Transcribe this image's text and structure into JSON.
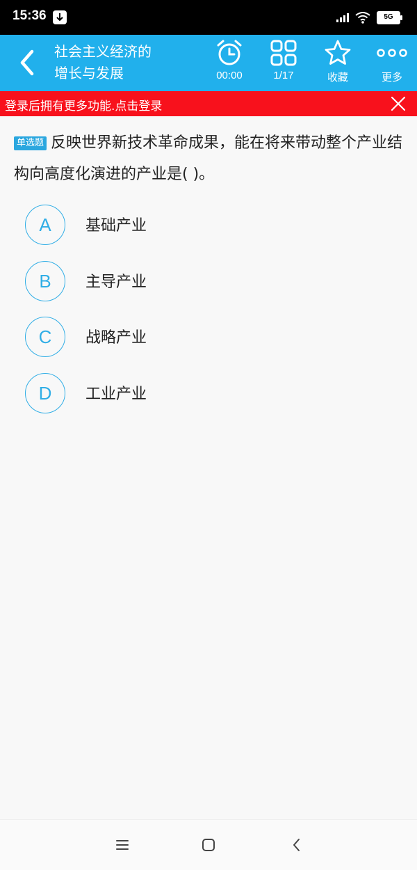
{
  "status_bar": {
    "time": "15:36",
    "network": "5G",
    "icons": [
      "download-icon",
      "signal-icon",
      "wifi-icon",
      "battery-icon"
    ]
  },
  "header": {
    "title_line1": "社会主义经济的",
    "title_line2": "增长与发展",
    "timer_label": "00:00",
    "progress_label": "1/17",
    "favorite_label": "收藏",
    "more_label": "更多",
    "icons": [
      "back-icon",
      "alarm-clock-icon",
      "grid-icon",
      "star-icon",
      "more-dots-icon"
    ]
  },
  "login_banner": {
    "text": "登录后拥有更多功能.点击登录",
    "icons": [
      "close-icon"
    ]
  },
  "question": {
    "badge": "单选题",
    "text": "反映世界新技术革命成果，能在将来带动整个产业结构向高度化演进的产业是(   )。",
    "options": [
      {
        "letter": "A",
        "text": "基础产业"
      },
      {
        "letter": "B",
        "text": "主导产业"
      },
      {
        "letter": "C",
        "text": "战略产业"
      },
      {
        "letter": "D",
        "text": "工业产业"
      }
    ]
  },
  "nav_bar": {
    "icons": [
      "menu-icon",
      "home-icon",
      "back-nav-icon"
    ]
  },
  "colors": {
    "header": "#21b0ec",
    "banner": "#f8111c",
    "option_accent": "#31aee6",
    "badge": "#2ba7df"
  }
}
